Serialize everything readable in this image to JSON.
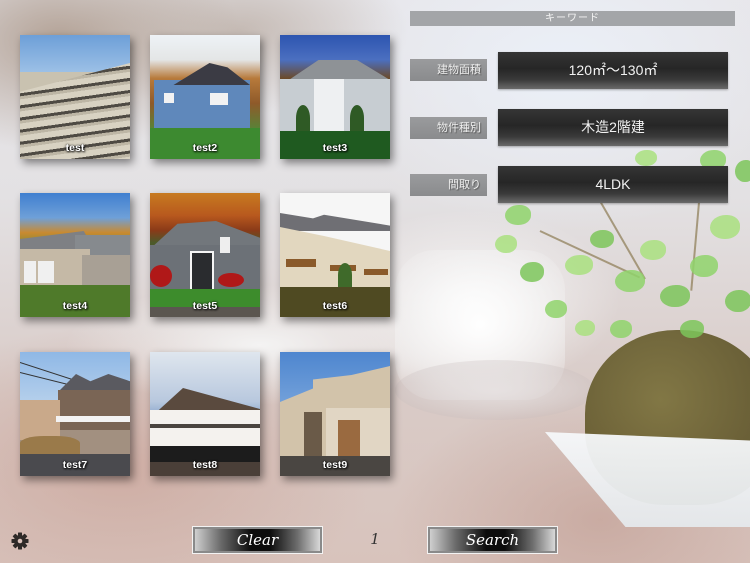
{
  "properties": [
    {
      "name": "test"
    },
    {
      "name": "test2"
    },
    {
      "name": "test3"
    },
    {
      "name": "test4"
    },
    {
      "name": "test5"
    },
    {
      "name": "test6"
    },
    {
      "name": "test7"
    },
    {
      "name": "test8"
    },
    {
      "name": "test9"
    }
  ],
  "keyword_panel": {
    "header": "キーワード",
    "fields": [
      {
        "label": "建物面積",
        "value": "120㎡〜130㎡"
      },
      {
        "label": "物件種別",
        "value": "木造2階建"
      },
      {
        "label": "間取り",
        "value": "4LDK"
      }
    ]
  },
  "footer": {
    "settings_icon": "gear-icon",
    "clear_label": "Clear",
    "page_number": "1",
    "search_label": "Search"
  },
  "colors": {
    "header_bar": "#a3a5a8",
    "value_box": "#262626",
    "label_box": "#9a9b9d"
  }
}
